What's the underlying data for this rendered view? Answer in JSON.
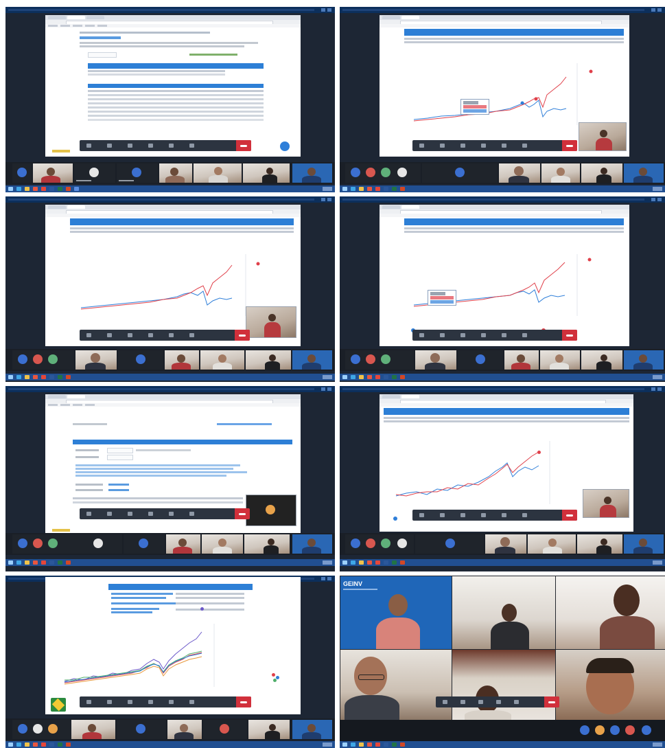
{
  "collage": {
    "columns": 2,
    "rows": 4
  },
  "colors": {
    "series_red": "#e0404a",
    "series_blue": "#2f7fd9",
    "series_purple": "#6b58c9",
    "series_orange": "#e8983c",
    "series_green": "#4fae6a",
    "window_title_bar": "#0c2f5c",
    "taskbar": "#214f91",
    "meeting_end_button": "#d1303b",
    "table_header": "#2d7fd6"
  },
  "meeting": {
    "icons": [
      "microphone-icon",
      "video-icon",
      "share-screen-icon",
      "chat-icon",
      "participants-icon",
      "more-icon",
      "end-call-icon"
    ]
  },
  "brand": {
    "label": "GEINV"
  },
  "icons": {
    "taskbar": [
      "start-icon",
      "browser-icon",
      "folder-icon",
      "mail-icon",
      "chrome-icon",
      "word-icon",
      "excel-icon",
      "powerpoint-icon",
      "meeting-icon"
    ]
  }
}
